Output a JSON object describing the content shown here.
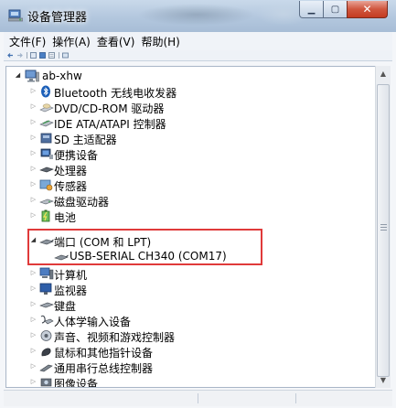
{
  "window": {
    "title": "设备管理器",
    "title_icon": "device-manager-icon",
    "buttons": {
      "minimize": "minimize-icon",
      "maximize": "maximize-icon",
      "close": "close-icon"
    }
  },
  "menu": {
    "items": [
      {
        "label": "文件(F)"
      },
      {
        "label": "操作(A)"
      },
      {
        "label": "查看(V)"
      },
      {
        "label": "帮助(H)"
      }
    ]
  },
  "tree": {
    "root": "ab-xhw",
    "items": [
      {
        "label": "Bluetooth 无线电收发器",
        "icon": "bluetooth-icon"
      },
      {
        "label": "DVD/CD-ROM 驱动器",
        "icon": "disc-drive-icon"
      },
      {
        "label": "IDE ATA/ATAPI 控制器",
        "icon": "ide-controller-icon"
      },
      {
        "label": "SD 主适配器",
        "icon": "sd-adapter-icon"
      },
      {
        "label": "便携设备",
        "icon": "portable-device-icon"
      },
      {
        "label": "处理器",
        "icon": "processor-icon"
      },
      {
        "label": "传感器",
        "icon": "sensor-icon"
      },
      {
        "label": "磁盘驱动器",
        "icon": "disk-drive-icon"
      },
      {
        "label": "电池",
        "icon": "battery-icon"
      },
      {
        "label": "端口 (COM 和 LPT)",
        "icon": "port-icon",
        "expanded": true
      },
      {
        "label": "USB-SERIAL CH340 (COM17)",
        "icon": "port-icon",
        "child": true
      },
      {
        "label": "计算机",
        "icon": "computer-icon"
      },
      {
        "label": "监视器",
        "icon": "monitor-icon"
      },
      {
        "label": "键盘",
        "icon": "keyboard-icon"
      },
      {
        "label": "人体学输入设备",
        "icon": "hid-icon"
      },
      {
        "label": "声音、视频和游戏控制器",
        "icon": "sound-icon"
      },
      {
        "label": "鼠标和其他指针设备",
        "icon": "mouse-icon"
      },
      {
        "label": "通用串行总线控制器",
        "icon": "usb-controller-icon"
      },
      {
        "label": "图像设备",
        "icon": "imaging-device-icon"
      }
    ]
  },
  "colors": {
    "highlight_border": "#e03a3a",
    "titlebar": "#b3c7de"
  }
}
